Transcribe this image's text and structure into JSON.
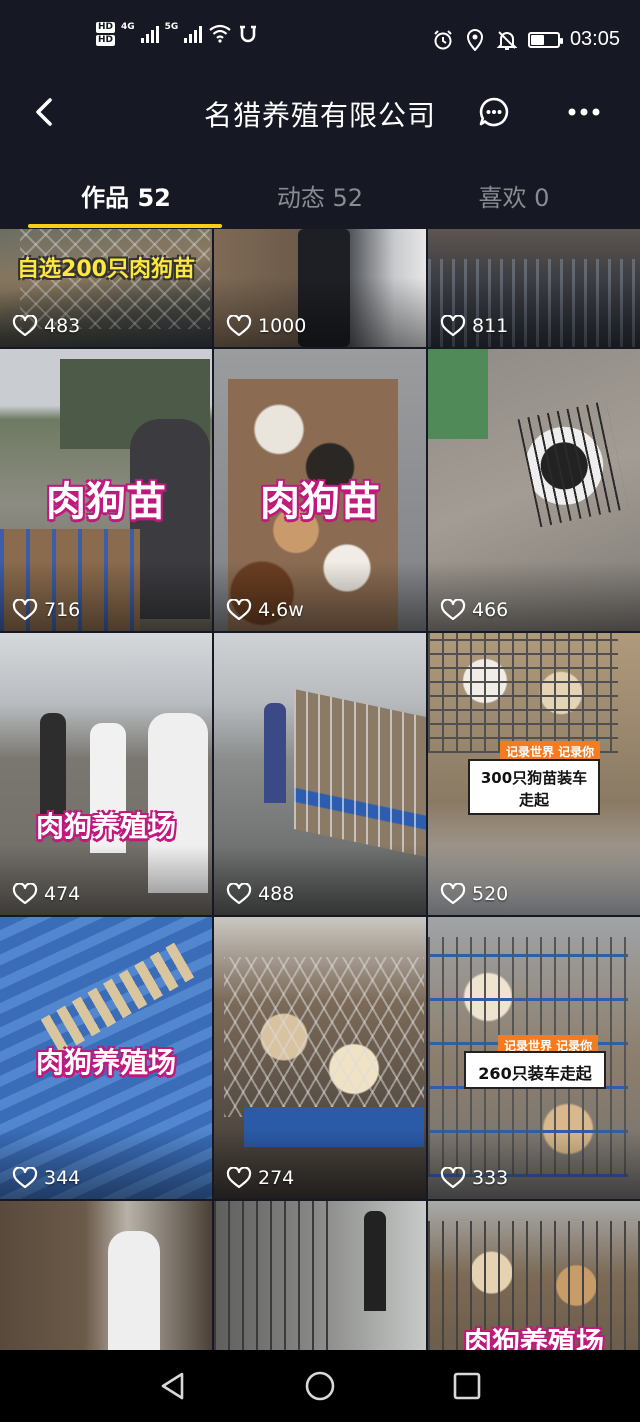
{
  "status_bar": {
    "hd1": "HD",
    "hd2": "HD",
    "net1": "4G",
    "net2": "5G",
    "battery_level": 0.5,
    "time": "03:05"
  },
  "header": {
    "title": "名猎养殖有限公司"
  },
  "tabs": [
    {
      "label": "作品 52",
      "active": true
    },
    {
      "label": "动态 52",
      "active": false
    },
    {
      "label": "喜欢 0",
      "active": false
    }
  ],
  "videos": [
    {
      "likes": "483",
      "caption": "自选200只肉狗苗"
    },
    {
      "likes": "1000"
    },
    {
      "likes": "811"
    },
    {
      "likes": "716",
      "caption": "肉狗苗"
    },
    {
      "likes": "4.6w",
      "caption": "肉狗苗"
    },
    {
      "likes": "466"
    },
    {
      "likes": "474",
      "caption": "肉狗养殖场"
    },
    {
      "likes": "488"
    },
    {
      "likes": "520",
      "sticker_tag": "记录世界 记录你",
      "sticker_line1": "300只狗苗装车",
      "sticker_line2": "走起"
    },
    {
      "likes": "344",
      "caption": "肉狗养殖场"
    },
    {
      "likes": "274"
    },
    {
      "likes": "333",
      "sticker_tag": "记录世界 记录你",
      "sticker_line1": "260只装车走起"
    },
    {
      "caption": ""
    },
    {},
    {
      "caption": "肉狗养殖场"
    }
  ],
  "colors": {
    "background": "#161823",
    "tab_indicator": "#face15",
    "caption_outline": "#c0187d",
    "sticker_tag": "#f47b20"
  }
}
